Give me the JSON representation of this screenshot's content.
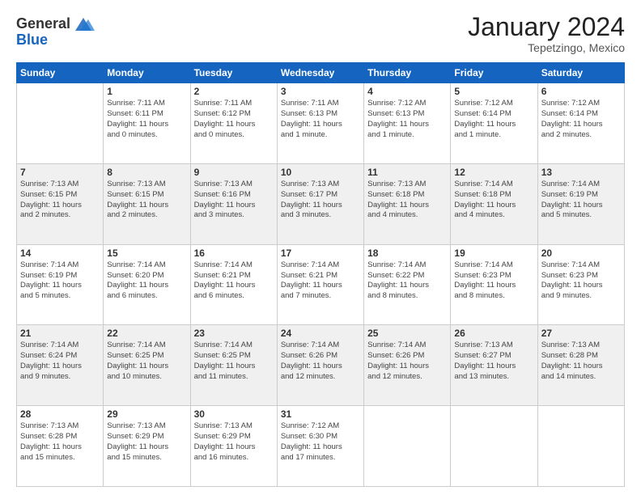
{
  "logo": {
    "general": "General",
    "blue": "Blue"
  },
  "title": "January 2024",
  "subtitle": "Tepetzingo, Mexico",
  "days": [
    "Sunday",
    "Monday",
    "Tuesday",
    "Wednesday",
    "Thursday",
    "Friday",
    "Saturday"
  ],
  "weeks": [
    [
      {
        "day": "",
        "info": ""
      },
      {
        "day": "1",
        "info": "Sunrise: 7:11 AM\nSunset: 6:11 PM\nDaylight: 11 hours\nand 0 minutes."
      },
      {
        "day": "2",
        "info": "Sunrise: 7:11 AM\nSunset: 6:12 PM\nDaylight: 11 hours\nand 0 minutes."
      },
      {
        "day": "3",
        "info": "Sunrise: 7:11 AM\nSunset: 6:13 PM\nDaylight: 11 hours\nand 1 minute."
      },
      {
        "day": "4",
        "info": "Sunrise: 7:12 AM\nSunset: 6:13 PM\nDaylight: 11 hours\nand 1 minute."
      },
      {
        "day": "5",
        "info": "Sunrise: 7:12 AM\nSunset: 6:14 PM\nDaylight: 11 hours\nand 1 minute."
      },
      {
        "day": "6",
        "info": "Sunrise: 7:12 AM\nSunset: 6:14 PM\nDaylight: 11 hours\nand 2 minutes."
      }
    ],
    [
      {
        "day": "7",
        "info": "Sunrise: 7:13 AM\nSunset: 6:15 PM\nDaylight: 11 hours\nand 2 minutes."
      },
      {
        "day": "8",
        "info": "Sunrise: 7:13 AM\nSunset: 6:15 PM\nDaylight: 11 hours\nand 2 minutes."
      },
      {
        "day": "9",
        "info": "Sunrise: 7:13 AM\nSunset: 6:16 PM\nDaylight: 11 hours\nand 3 minutes."
      },
      {
        "day": "10",
        "info": "Sunrise: 7:13 AM\nSunset: 6:17 PM\nDaylight: 11 hours\nand 3 minutes."
      },
      {
        "day": "11",
        "info": "Sunrise: 7:13 AM\nSunset: 6:18 PM\nDaylight: 11 hours\nand 4 minutes."
      },
      {
        "day": "12",
        "info": "Sunrise: 7:14 AM\nSunset: 6:18 PM\nDaylight: 11 hours\nand 4 minutes."
      },
      {
        "day": "13",
        "info": "Sunrise: 7:14 AM\nSunset: 6:19 PM\nDaylight: 11 hours\nand 5 minutes."
      }
    ],
    [
      {
        "day": "14",
        "info": "Sunrise: 7:14 AM\nSunset: 6:19 PM\nDaylight: 11 hours\nand 5 minutes."
      },
      {
        "day": "15",
        "info": "Sunrise: 7:14 AM\nSunset: 6:20 PM\nDaylight: 11 hours\nand 6 minutes."
      },
      {
        "day": "16",
        "info": "Sunrise: 7:14 AM\nSunset: 6:21 PM\nDaylight: 11 hours\nand 6 minutes."
      },
      {
        "day": "17",
        "info": "Sunrise: 7:14 AM\nSunset: 6:21 PM\nDaylight: 11 hours\nand 7 minutes."
      },
      {
        "day": "18",
        "info": "Sunrise: 7:14 AM\nSunset: 6:22 PM\nDaylight: 11 hours\nand 8 minutes."
      },
      {
        "day": "19",
        "info": "Sunrise: 7:14 AM\nSunset: 6:23 PM\nDaylight: 11 hours\nand 8 minutes."
      },
      {
        "day": "20",
        "info": "Sunrise: 7:14 AM\nSunset: 6:23 PM\nDaylight: 11 hours\nand 9 minutes."
      }
    ],
    [
      {
        "day": "21",
        "info": "Sunrise: 7:14 AM\nSunset: 6:24 PM\nDaylight: 11 hours\nand 9 minutes."
      },
      {
        "day": "22",
        "info": "Sunrise: 7:14 AM\nSunset: 6:25 PM\nDaylight: 11 hours\nand 10 minutes."
      },
      {
        "day": "23",
        "info": "Sunrise: 7:14 AM\nSunset: 6:25 PM\nDaylight: 11 hours\nand 11 minutes."
      },
      {
        "day": "24",
        "info": "Sunrise: 7:14 AM\nSunset: 6:26 PM\nDaylight: 11 hours\nand 12 minutes."
      },
      {
        "day": "25",
        "info": "Sunrise: 7:14 AM\nSunset: 6:26 PM\nDaylight: 11 hours\nand 12 minutes."
      },
      {
        "day": "26",
        "info": "Sunrise: 7:13 AM\nSunset: 6:27 PM\nDaylight: 11 hours\nand 13 minutes."
      },
      {
        "day": "27",
        "info": "Sunrise: 7:13 AM\nSunset: 6:28 PM\nDaylight: 11 hours\nand 14 minutes."
      }
    ],
    [
      {
        "day": "28",
        "info": "Sunrise: 7:13 AM\nSunset: 6:28 PM\nDaylight: 11 hours\nand 15 minutes."
      },
      {
        "day": "29",
        "info": "Sunrise: 7:13 AM\nSunset: 6:29 PM\nDaylight: 11 hours\nand 15 minutes."
      },
      {
        "day": "30",
        "info": "Sunrise: 7:13 AM\nSunset: 6:29 PM\nDaylight: 11 hours\nand 16 minutes."
      },
      {
        "day": "31",
        "info": "Sunrise: 7:12 AM\nSunset: 6:30 PM\nDaylight: 11 hours\nand 17 minutes."
      },
      {
        "day": "",
        "info": ""
      },
      {
        "day": "",
        "info": ""
      },
      {
        "day": "",
        "info": ""
      }
    ]
  ]
}
